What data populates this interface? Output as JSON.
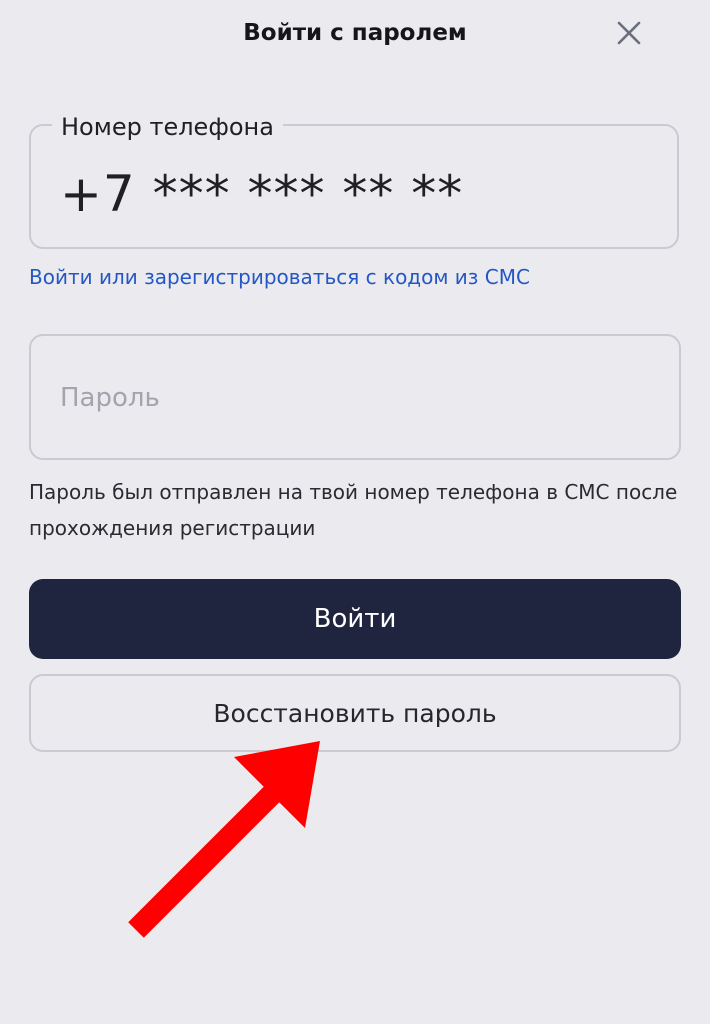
{
  "header": {
    "title": "Войти с паролем",
    "close_icon": "close-icon"
  },
  "phone_field": {
    "label": "Номер телефона",
    "value": "+7 *** *** ** **"
  },
  "sms_link": {
    "label": "Войти или зарегистрироваться с кодом из СМС"
  },
  "password_field": {
    "placeholder": "Пароль",
    "value": ""
  },
  "hint": {
    "text": "Пароль был отправлен на твой номер телефона в СМС после прохождения регистрации"
  },
  "buttons": {
    "login_label": "Войти",
    "restore_label": "Восстановить пароль"
  },
  "annotation": {
    "arrow_icon": "arrow-up-right-icon",
    "arrow_color": "#ff0000"
  },
  "colors": {
    "background": "#ebebef",
    "primary_button": "#20253f",
    "link": "#2457c5",
    "border": "#c9cad2"
  }
}
